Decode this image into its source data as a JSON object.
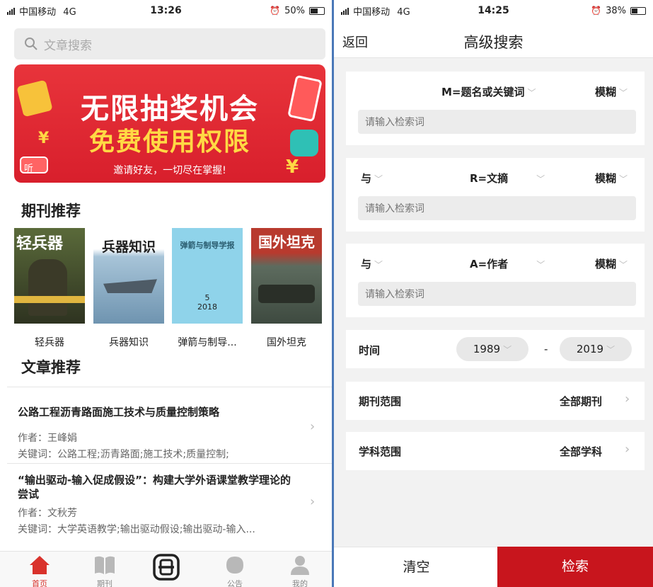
{
  "left": {
    "status": {
      "carrier": "中国移动",
      "network": "4G",
      "time": "13:26",
      "battery": "50%",
      "battery_level": 0.5
    },
    "search": {
      "placeholder": "文章搜索"
    },
    "banner": {
      "line1": "无限抽奖机会",
      "line2": "免费使用权限",
      "line3": "邀请好友，一切尽在掌握!",
      "yen": "¥",
      "tag": "听"
    },
    "journals_title": "期刊推荐",
    "journals": [
      {
        "name": "轻兵器",
        "cover_title": "轻兵器",
        "color": "#4a5236"
      },
      {
        "name": "兵器知识",
        "cover_title": "兵器知识",
        "color": "#8fb3cc"
      },
      {
        "name": "弹箭与制导...",
        "cover_title": "弹箭与制导学报",
        "color": "#8fd3ea"
      },
      {
        "name": "国外坦克",
        "cover_title": "国外坦克",
        "color": "#b83a2e"
      }
    ],
    "articles_title": "文章推荐",
    "articles": [
      {
        "title": "公路工程沥青路面施工技术与质量控制策略",
        "author": "作者：王峰娟",
        "keywords": "关键词：公路工程;沥青路面;施工技术;质量控制;"
      },
      {
        "title": "“输出驱动-输入促成假设”：构建大学外语课堂教学理论的尝试",
        "author": "作者：文秋芳",
        "keywords": "关键词：大学英语教学;输出驱动假设;输出驱动-输入..."
      }
    ],
    "tabs": [
      {
        "label": "首页"
      },
      {
        "label": "期刊"
      },
      {
        "label": ""
      },
      {
        "label": "公告"
      },
      {
        "label": "我的"
      }
    ],
    "accent": "#d9322c"
  },
  "right": {
    "status": {
      "carrier": "中国移动",
      "network": "4G",
      "time": "14:25",
      "battery": "38%",
      "battery_level": 0.38
    },
    "nav": {
      "back": "返回",
      "title": "高级搜索"
    },
    "blocks": [
      {
        "logic": "",
        "field": "M=题名或关键词",
        "match": "模糊",
        "placeholder": "请输入检索词"
      },
      {
        "logic": "与",
        "field": "R=文摘",
        "match": "模糊",
        "placeholder": "请输入检索词"
      },
      {
        "logic": "与",
        "field": "A=作者",
        "match": "模糊",
        "placeholder": "请输入检索词"
      }
    ],
    "time": {
      "label": "时间",
      "from": "1989",
      "separator": "-",
      "to": "2019"
    },
    "journal_scope": {
      "label": "期刊范围",
      "value": "全部期刊"
    },
    "subject_scope": {
      "label": "学科范围",
      "value": "全部学科"
    },
    "clear_label": "清空",
    "search_label": "检索",
    "accent": "#c8151d"
  }
}
